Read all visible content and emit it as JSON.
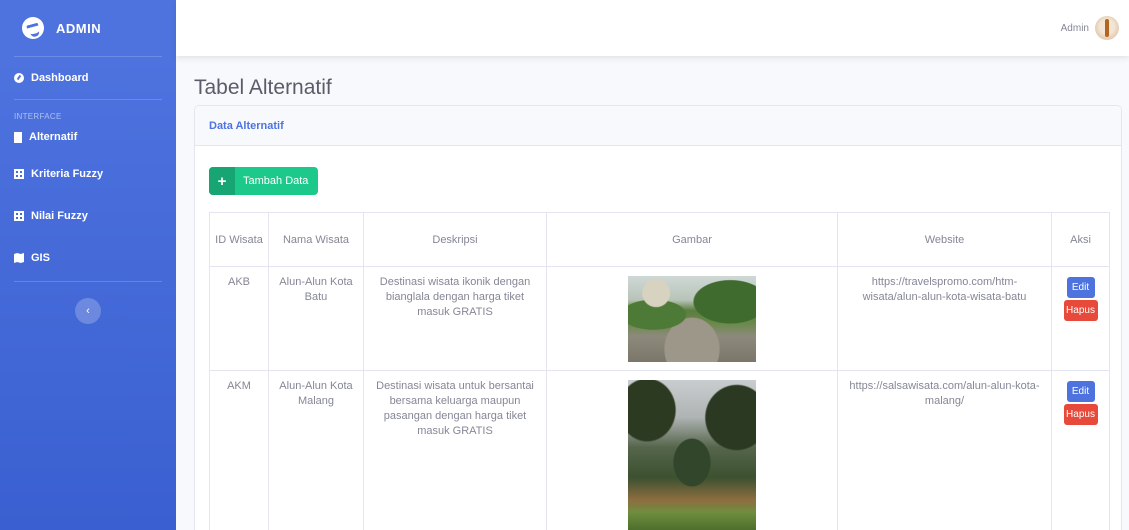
{
  "sidebar": {
    "brand": "ADMIN",
    "dashboard": "Dashboard",
    "heading": "INTERFACE",
    "items": [
      {
        "label": "Alternatif",
        "icon": "building-icon"
      },
      {
        "label": "Kriteria Fuzzy",
        "icon": "table-icon"
      },
      {
        "label": "Nilai Fuzzy",
        "icon": "table-icon"
      },
      {
        "label": "GIS",
        "icon": "map-icon"
      }
    ],
    "toggle": "‹"
  },
  "topbar": {
    "user": "Admin"
  },
  "page": {
    "title": "Tabel Alternatif"
  },
  "card": {
    "header": "Data Alternatif",
    "add_button": "Tambah Data",
    "add_icon": "+"
  },
  "table": {
    "headers": [
      "ID Wisata",
      "Nama Wisata",
      "Deskripsi",
      "Gambar",
      "Website",
      "Aksi"
    ],
    "rows": [
      {
        "id": "AKB",
        "nama": "Alun-Alun Kota Batu",
        "deskripsi": "Destinasi wisata ikonik dengan bianglala dengan harga tiket masuk GRATIS",
        "website": "https://travelspromo.com/htm-wisata/alun-alun-kota-wisata-batu",
        "edit": "Edit",
        "hapus": "Hapus"
      },
      {
        "id": "AKM",
        "nama": "Alun-Alun Kota Malang",
        "deskripsi": "Destinasi wisata untuk bersantai bersama keluarga maupun pasangan dengan harga tiket masuk GRATIS",
        "website": "https://salsawisata.com/alun-alun-kota-malang/",
        "edit": "Edit",
        "hapus": "Hapus"
      }
    ]
  },
  "colors": {
    "primary": "#4e73df",
    "success": "#1cc88a",
    "danger": "#e74a3b"
  }
}
